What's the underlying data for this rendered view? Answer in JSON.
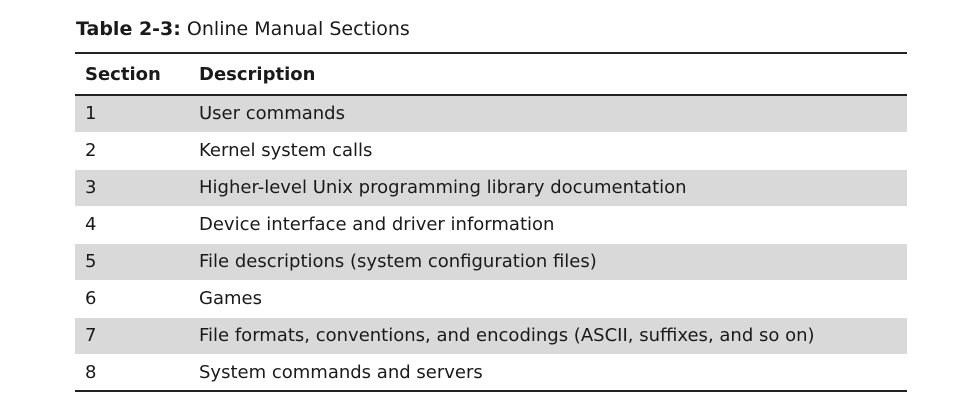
{
  "caption": {
    "label": "Table 2-3:",
    "title": " Online Manual Sections"
  },
  "table": {
    "headers": [
      "Section",
      "Description"
    ],
    "rows": [
      {
        "section": "1",
        "description": "User commands"
      },
      {
        "section": "2",
        "description": "Kernel system calls"
      },
      {
        "section": "3",
        "description": "Higher-level Unix programming library documentation"
      },
      {
        "section": "4",
        "description": "Device interface and driver information"
      },
      {
        "section": "5",
        "description": "File descriptions (system configuration files)"
      },
      {
        "section": "6",
        "description": "Games"
      },
      {
        "section": "7",
        "description": "File formats, conventions, and encodings (ASCII, suffixes, and so on)"
      },
      {
        "section": "8",
        "description": "System commands and servers"
      }
    ]
  },
  "colors": {
    "stripe": "#d9d9d9",
    "rule": "#222222"
  }
}
